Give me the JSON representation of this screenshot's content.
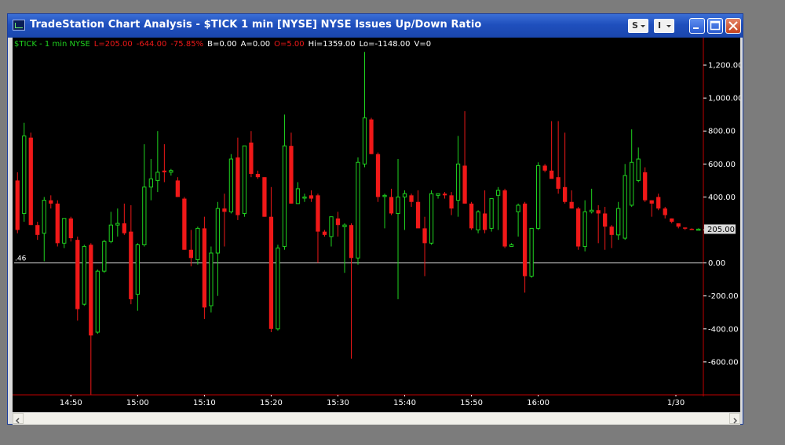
{
  "window": {
    "title": "TradeStation Chart Analysis - $TICK  1 min  [NYSE] NYSE Issues Up/Down Ratio",
    "menu_s": "S",
    "menu_i": "I"
  },
  "info_bar": {
    "symbol": "$TICK - 1 min  NYSE",
    "last": "L=205.00",
    "change": "-644.00",
    "pct": "-75.85%",
    "bid": "B=0.00",
    "ask": "A=0.00",
    "open": "O=5.00",
    "high": "Hi=1359.00",
    "low": "Lo=-1148.00",
    "volume": "V=0"
  },
  "colors": {
    "background": "#000000",
    "up": "#1fd41f",
    "down": "#f01818",
    "price_axis_line": "#c00000",
    "zero_line": "#d8d8d8",
    "text": "#ffffff",
    "last_price_box": "#d9d9d9"
  },
  "chart_data": {
    "type": "candlestick",
    "ylim": [
      -800,
      1300
    ],
    "y_ticks": [
      1200,
      1000,
      800,
      600,
      400,
      200,
      0,
      -200,
      -400,
      -600
    ],
    "y_tick_labels": [
      "1,200.00",
      "1,000.00",
      "800.00",
      "600.00",
      "400.00",
      "",
      "0.00",
      "-200.00",
      "-400.00",
      "-600.00"
    ],
    "x_ticks": [
      "14:50",
      "15:00",
      "15:10",
      "15:20",
      "15:30",
      "15:40",
      "15:50",
      "16:00",
      "1/30"
    ],
    "last_price_label": "205.00",
    "zero_line_label": ".46",
    "candles": [
      {
        "o": 500,
        "h": 550,
        "l": 180,
        "c": 200
      },
      {
        "o": 300,
        "h": 850,
        "l": 250,
        "c": 770
      },
      {
        "o": 760,
        "h": 790,
        "l": 230,
        "c": 230
      },
      {
        "o": 230,
        "h": 250,
        "l": 140,
        "c": 170
      },
      {
        "o": 180,
        "h": 400,
        "l": 10,
        "c": 380
      },
      {
        "o": 380,
        "h": 410,
        "l": 330,
        "c": 360
      },
      {
        "o": 360,
        "h": 380,
        "l": 100,
        "c": 120
      },
      {
        "o": 120,
        "h": 270,
        "l": 90,
        "c": 270
      },
      {
        "o": 270,
        "h": 280,
        "l": 130,
        "c": 150
      },
      {
        "o": 140,
        "h": 160,
        "l": -350,
        "c": -280
      },
      {
        "o": -250,
        "h": 110,
        "l": -260,
        "c": 100
      },
      {
        "o": 110,
        "h": 120,
        "l": -800,
        "c": -440
      },
      {
        "o": -420,
        "h": -40,
        "l": -430,
        "c": -50
      },
      {
        "o": -50,
        "h": 140,
        "l": -60,
        "c": 130
      },
      {
        "o": 130,
        "h": 310,
        "l": 120,
        "c": 230
      },
      {
        "o": 230,
        "h": 330,
        "l": 160,
        "c": 240
      },
      {
        "o": 240,
        "h": 360,
        "l": 170,
        "c": 180
      },
      {
        "o": 190,
        "h": 350,
        "l": -250,
        "c": -220
      },
      {
        "o": -190,
        "h": 120,
        "l": -290,
        "c": 110
      },
      {
        "o": 110,
        "h": 720,
        "l": 100,
        "c": 460
      },
      {
        "o": 460,
        "h": 630,
        "l": 380,
        "c": 510
      },
      {
        "o": 500,
        "h": 800,
        "l": 430,
        "c": 550
      },
      {
        "o": 560,
        "h": 720,
        "l": 490,
        "c": 550
      },
      {
        "o": 550,
        "h": 570,
        "l": 530,
        "c": 560
      },
      {
        "o": 500,
        "h": 520,
        "l": 400,
        "c": 400
      },
      {
        "o": 390,
        "h": 400,
        "l": 80,
        "c": 80
      },
      {
        "o": 80,
        "h": 200,
        "l": -20,
        "c": 30
      },
      {
        "o": 20,
        "h": 220,
        "l": -10,
        "c": 210
      },
      {
        "o": 210,
        "h": 280,
        "l": -340,
        "c": -270
      },
      {
        "o": -260,
        "h": 100,
        "l": -300,
        "c": 60
      },
      {
        "o": 60,
        "h": 370,
        "l": -200,
        "c": 330
      },
      {
        "o": 330,
        "h": 420,
        "l": 100,
        "c": 310
      },
      {
        "o": 310,
        "h": 660,
        "l": 300,
        "c": 630
      },
      {
        "o": 640,
        "h": 760,
        "l": 260,
        "c": 290
      },
      {
        "o": 300,
        "h": 700,
        "l": 280,
        "c": 710
      },
      {
        "o": 730,
        "h": 800,
        "l": 520,
        "c": 540
      },
      {
        "o": 540,
        "h": 560,
        "l": 510,
        "c": 520
      },
      {
        "o": 520,
        "h": 520,
        "l": 280,
        "c": 280
      },
      {
        "o": 280,
        "h": 460,
        "l": -420,
        "c": -400
      },
      {
        "o": -400,
        "h": 110,
        "l": -410,
        "c": 90
      },
      {
        "o": 100,
        "h": 900,
        "l": 80,
        "c": 710
      },
      {
        "o": 710,
        "h": 790,
        "l": 360,
        "c": 360
      },
      {
        "o": 360,
        "h": 490,
        "l": 360,
        "c": 450
      },
      {
        "o": 400,
        "h": 420,
        "l": 370,
        "c": 400
      },
      {
        "o": 410,
        "h": 440,
        "l": 370,
        "c": 390
      },
      {
        "o": 410,
        "h": 420,
        "l": 0,
        "c": 190
      },
      {
        "o": 190,
        "h": 200,
        "l": 160,
        "c": 170
      },
      {
        "o": 160,
        "h": 270,
        "l": 100,
        "c": 280
      },
      {
        "o": 270,
        "h": 310,
        "l": 160,
        "c": 230
      },
      {
        "o": 220,
        "h": 240,
        "l": -60,
        "c": 230
      },
      {
        "o": 230,
        "h": 240,
        "l": -580,
        "c": 30
      },
      {
        "o": 30,
        "h": 640,
        "l": -10,
        "c": 610
      },
      {
        "o": 600,
        "h": 1280,
        "l": 580,
        "c": 880
      },
      {
        "o": 870,
        "h": 880,
        "l": 660,
        "c": 660
      },
      {
        "o": 660,
        "h": 670,
        "l": 370,
        "c": 400
      },
      {
        "o": 410,
        "h": 420,
        "l": 210,
        "c": 410
      },
      {
        "o": 400,
        "h": 450,
        "l": 290,
        "c": 300
      },
      {
        "o": 300,
        "h": 630,
        "l": -220,
        "c": 400
      },
      {
        "o": 400,
        "h": 440,
        "l": 200,
        "c": 420
      },
      {
        "o": 410,
        "h": 420,
        "l": 340,
        "c": 370
      },
      {
        "o": 370,
        "h": 440,
        "l": 240,
        "c": 210
      },
      {
        "o": 210,
        "h": 280,
        "l": -80,
        "c": 120
      },
      {
        "o": 120,
        "h": 440,
        "l": 110,
        "c": 420
      },
      {
        "o": 410,
        "h": 420,
        "l": 390,
        "c": 420
      },
      {
        "o": 420,
        "h": 430,
        "l": 390,
        "c": 410
      },
      {
        "o": 410,
        "h": 430,
        "l": 290,
        "c": 330
      },
      {
        "o": 380,
        "h": 770,
        "l": 280,
        "c": 600
      },
      {
        "o": 590,
        "h": 920,
        "l": 360,
        "c": 360
      },
      {
        "o": 360,
        "h": 370,
        "l": 200,
        "c": 210
      },
      {
        "o": 200,
        "h": 320,
        "l": 180,
        "c": 310
      },
      {
        "o": 300,
        "h": 440,
        "l": 180,
        "c": 200
      },
      {
        "o": 210,
        "h": 380,
        "l": 190,
        "c": 390
      },
      {
        "o": 410,
        "h": 460,
        "l": 200,
        "c": 440
      },
      {
        "o": 440,
        "h": 450,
        "l": 90,
        "c": 100
      },
      {
        "o": 100,
        "h": 120,
        "l": 100,
        "c": 110
      },
      {
        "o": 310,
        "h": 360,
        "l": 160,
        "c": 350
      },
      {
        "o": 360,
        "h": 370,
        "l": -180,
        "c": -80
      },
      {
        "o": -80,
        "h": 210,
        "l": -90,
        "c": 210
      },
      {
        "o": 210,
        "h": 610,
        "l": 200,
        "c": 590
      },
      {
        "o": 590,
        "h": 600,
        "l": 550,
        "c": 560
      },
      {
        "o": 560,
        "h": 860,
        "l": 540,
        "c": 510
      },
      {
        "o": 520,
        "h": 860,
        "l": 420,
        "c": 450
      },
      {
        "o": 460,
        "h": 790,
        "l": 360,
        "c": 370
      },
      {
        "o": 370,
        "h": 440,
        "l": 330,
        "c": 330
      },
      {
        "o": 330,
        "h": 340,
        "l": 80,
        "c": 100
      },
      {
        "o": 100,
        "h": 380,
        "l": 70,
        "c": 310
      },
      {
        "o": 310,
        "h": 450,
        "l": 300,
        "c": 320
      },
      {
        "o": 320,
        "h": 350,
        "l": 120,
        "c": 300
      },
      {
        "o": 300,
        "h": 340,
        "l": 80,
        "c": 220
      },
      {
        "o": 220,
        "h": 230,
        "l": 90,
        "c": 170
      },
      {
        "o": 170,
        "h": 370,
        "l": 140,
        "c": 330
      },
      {
        "o": 150,
        "h": 600,
        "l": 140,
        "c": 530
      },
      {
        "o": 350,
        "h": 810,
        "l": 340,
        "c": 610
      },
      {
        "o": 500,
        "h": 700,
        "l": 490,
        "c": 630
      },
      {
        "o": 550,
        "h": 580,
        "l": 370,
        "c": 380
      },
      {
        "o": 380,
        "h": 380,
        "l": 280,
        "c": 360
      },
      {
        "o": 400,
        "h": 420,
        "l": 320,
        "c": 330
      },
      {
        "o": 330,
        "h": 340,
        "l": 270,
        "c": 290
      },
      {
        "o": 270,
        "h": 270,
        "l": 240,
        "c": 250
      },
      {
        "o": 240,
        "h": 240,
        "l": 210,
        "c": 220
      },
      {
        "o": 215,
        "h": 215,
        "l": 200,
        "c": 210
      },
      {
        "o": 207,
        "h": 210,
        "l": 200,
        "c": 205
      },
      {
        "o": 205,
        "h": 210,
        "l": 200,
        "c": 205
      }
    ]
  }
}
